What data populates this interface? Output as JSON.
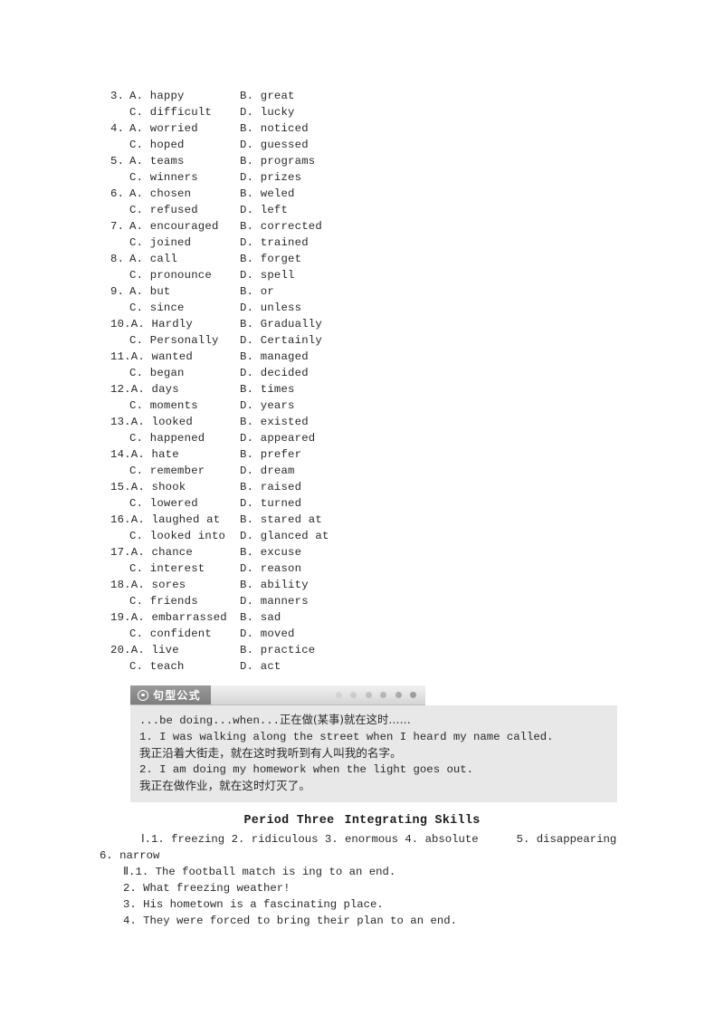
{
  "multiple_choice": {
    "items": [
      {
        "num": "3.",
        "a": "A. happy",
        "b": "B. great",
        "c": "C. difficult",
        "d": "D. lucky"
      },
      {
        "num": "4.",
        "a": "A. worried",
        "b": "B. noticed",
        "c": "C. hoped",
        "d": "D. guessed"
      },
      {
        "num": "5.",
        "a": "A. teams",
        "b": "B. programs",
        "c": "C. winners",
        "d": "D. prizes"
      },
      {
        "num": "6.",
        "a": "A. chosen",
        "b": "B. weled",
        "c": "C. refused",
        "d": "D. left"
      },
      {
        "num": "7.",
        "a": "A. encouraged",
        "b": "B. corrected",
        "c": "C. joined",
        "d": "D. trained"
      },
      {
        "num": "8.",
        "a": "A. call",
        "b": "B. forget",
        "c": "C. pronounce",
        "d": "D. spell"
      },
      {
        "num": "9.",
        "a": "A. but",
        "b": "B. or",
        "c": "C. since",
        "d": "D. unless"
      },
      {
        "num": "10.",
        "a": "A. Hardly",
        "b": "B. Gradually",
        "c": "C. Personally",
        "d": "D. Certainly"
      },
      {
        "num": "11.",
        "a": "A. wanted",
        "b": "B. managed",
        "c": "C. began",
        "d": "D. decided"
      },
      {
        "num": "12.",
        "a": "A. days",
        "b": "B. times",
        "c": "C. moments",
        "d": "D. years"
      },
      {
        "num": "13.",
        "a": "A. looked",
        "b": "B. existed",
        "c": "C. happened",
        "d": "D. appeared"
      },
      {
        "num": "14.",
        "a": "A. hate",
        "b": "B. prefer",
        "c": "C. remember",
        "d": "D. dream"
      },
      {
        "num": "15.",
        "a": "A. shook",
        "b": "B. raised",
        "c": "C. lowered",
        "d": "D. turned"
      },
      {
        "num": "16.",
        "a": "A. laughed at",
        "b": "B. stared at",
        "c": "C. looked into",
        "d": "D. glanced at"
      },
      {
        "num": "17.",
        "a": "A. chance",
        "b": "B. excuse",
        "c": "C. interest",
        "d": "D. reason"
      },
      {
        "num": "18.",
        "a": "A. sores",
        "b": "B. ability",
        "c": "C. friends",
        "d": "D. manners"
      },
      {
        "num": "19.",
        "a": "A. embarrassed",
        "b": "B. sad",
        "c": "C. confident",
        "d": "D. moved"
      },
      {
        "num": "20.",
        "a": "A. live",
        "b": "B. practice",
        "c": "C. teach",
        "d": "D. act"
      }
    ]
  },
  "callout": {
    "title": "句型公式",
    "icon": "bullseye-icon",
    "dot_count": 6,
    "formula_en": "...be doing...when...",
    "formula_cn": "正在做(某事)就在这时……",
    "lines": [
      "1. I was walking along the street when I heard my name called.",
      "我正沿着大街走，就在这时我听到有人叫我的名字。",
      "2. I am doing my homework when the light goes out.",
      "我正在做作业，就在这时灯灭了。"
    ]
  },
  "period": {
    "title_left": "Period Three",
    "title_right": "Integrating Skills",
    "section_1": {
      "roman": "Ⅰ.",
      "answers_line1": "1. freezing  2. ridiculous  3. enormous  4. absolute",
      "answers_line1_tail": "5. disappearing",
      "answers_line2": "6. narrow"
    },
    "section_2": {
      "roman": "Ⅱ.",
      "first": "1. The football match is ing to an end.",
      "rest": [
        "2. What freezing weather!",
        "3. His hometown is a fascinating place.",
        "4. They were forced to bring their plan to an end."
      ]
    }
  }
}
